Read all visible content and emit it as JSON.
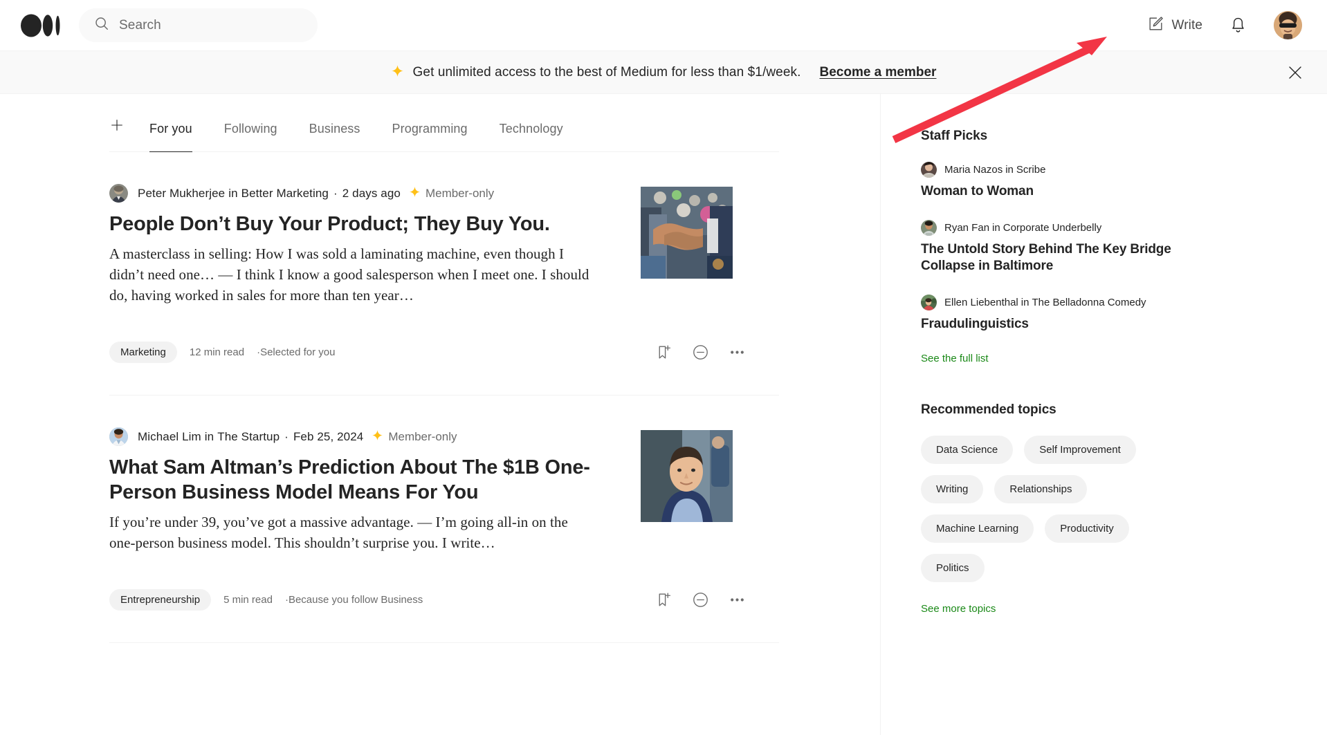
{
  "nav": {
    "logo_icon": "medium-logo-icon",
    "search": {
      "placeholder": "Search",
      "icon": "search-icon",
      "value": ""
    },
    "write": {
      "label": "Write",
      "icon": "write-pencil-square-icon"
    },
    "notifications_icon": "bell-icon",
    "avatar_label": "user-avatar"
  },
  "promo": {
    "star_icon": "star-icon",
    "text": "Get unlimited access to the best of Medium for less than $1/week.",
    "link": "Become a member",
    "close_icon": "close-icon"
  },
  "tabs": {
    "plus_icon": "plus-icon",
    "items": [
      {
        "label": "For you",
        "active": true
      },
      {
        "label": "Following",
        "active": false
      },
      {
        "label": "Business",
        "active": false
      },
      {
        "label": "Programming",
        "active": false
      },
      {
        "label": "Technology",
        "active": false
      }
    ]
  },
  "feed": [
    {
      "author": "Peter Mukherjee",
      "in_word": "in",
      "publication": "Better Marketing",
      "date": "2 days ago",
      "member_badge": "Member-only",
      "title": "People Don’t Buy Your Product; They Buy You.",
      "excerpt": "A masterclass in selling: How I was sold a laminating machine, even though I didn’t need one… — I think I know a good salesperson when I meet one. I should do, having worked in sales for more than ten year…",
      "tag": "Marketing",
      "read_time": "12 min read",
      "reason": "Selected for you",
      "thumb_alt": "handshake-photo"
    },
    {
      "author": "Michael Lim",
      "in_word": "in",
      "publication": "The Startup",
      "date": "Feb 25, 2024",
      "member_badge": "Member-only",
      "title": "What Sam Altman’s Prediction About The $1B One-Person Business Model Means For You",
      "excerpt": "If you’re under 39, you’ve got a massive advantage. — I’m going all-in on the one-person business model. This shouldn’t surprise you. I write…",
      "tag": "Entrepreneurship",
      "read_time": "5 min read",
      "reason": "Because you follow Business",
      "thumb_alt": "sam-altman-photo"
    }
  ],
  "sidebar": {
    "staff_picks_heading": "Staff Picks",
    "picks": [
      {
        "author": "Maria Nazos",
        "in_word": "in",
        "publication": "Scribe",
        "title": "Woman to Woman"
      },
      {
        "author": "Ryan Fan",
        "in_word": "in",
        "publication": "Corporate Underbelly",
        "title": "The Untold Story Behind The Key Bridge Collapse in Baltimore"
      },
      {
        "author": "Ellen Liebenthal",
        "in_word": "in",
        "publication": "The Belladonna Comedy",
        "title": "Fraudulinguistics"
      }
    ],
    "see_full_list": "See the full list",
    "topics_heading": "Recommended topics",
    "topics": [
      "Data Science",
      "Self Improvement",
      "Writing",
      "Relationships",
      "Machine Learning",
      "Productivity",
      "Politics"
    ],
    "see_more_topics": "See more topics"
  },
  "annotation": {
    "type": "arrow",
    "color": "#F23545",
    "points_to": "write-button"
  },
  "icons": {
    "bookmark_add": "bookmark-plus-icon",
    "mute": "minus-circle-icon",
    "more": "ellipsis-icon"
  },
  "colors": {
    "accent_green": "#1a8917",
    "star_gold": "#FFC017",
    "text_primary": "#242424",
    "text_secondary": "#6b6b6b",
    "pill_bg": "#f2f2f2",
    "annotation_red": "#F23545"
  }
}
